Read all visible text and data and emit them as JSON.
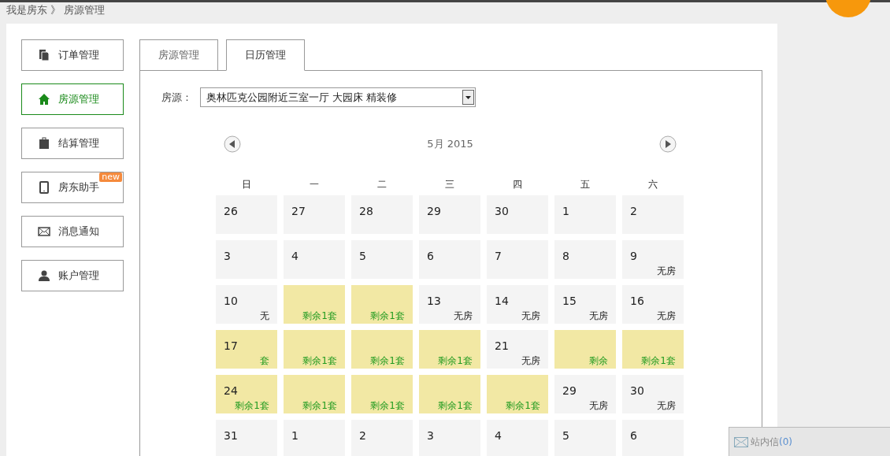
{
  "breadcrumb": {
    "parent": "我是房东",
    "separator": "》",
    "current": "房源管理"
  },
  "sidebar": {
    "items": [
      {
        "label": "订单管理",
        "selected": false
      },
      {
        "label": "房源管理",
        "selected": true
      },
      {
        "label": "结算管理",
        "selected": false
      },
      {
        "label": "房东助手",
        "selected": false,
        "badge": "new"
      },
      {
        "label": "消息通知",
        "selected": false
      },
      {
        "label": "账户管理",
        "selected": false
      }
    ]
  },
  "tabs": [
    {
      "label": "房源管理",
      "selected": false
    },
    {
      "label": "日历管理",
      "selected": true
    }
  ],
  "listing": {
    "label": "房源：",
    "value": "奥林匹克公园附近三室一厅 大园床 精装修"
  },
  "calendar": {
    "month": "5月 2015",
    "weekdays": [
      "日",
      "一",
      "二",
      "三",
      "四",
      "五",
      "六"
    ],
    "days": [
      {
        "day": "26",
        "kind": "plain"
      },
      {
        "day": "27",
        "kind": "plain"
      },
      {
        "day": "28",
        "kind": "plain"
      },
      {
        "day": "29",
        "kind": "plain"
      },
      {
        "day": "30",
        "kind": "plain"
      },
      {
        "day": "1",
        "kind": "plain"
      },
      {
        "day": "2",
        "kind": "plain"
      },
      {
        "day": "3",
        "kind": "plain"
      },
      {
        "day": "4",
        "kind": "plain"
      },
      {
        "day": "5",
        "kind": "plain"
      },
      {
        "day": "6",
        "kind": "plain"
      },
      {
        "day": "7",
        "kind": "plain"
      },
      {
        "day": "8",
        "kind": "plain"
      },
      {
        "day": "9",
        "kind": "none",
        "status": "无房"
      },
      {
        "day": "10",
        "kind": "none",
        "status": "无"
      },
      {
        "kind": "available",
        "status": "剩余1套"
      },
      {
        "kind": "available",
        "status": "剩余1套"
      },
      {
        "day": "13",
        "kind": "none",
        "status": "无房"
      },
      {
        "day": "14",
        "kind": "none",
        "status": "无房"
      },
      {
        "day": "15",
        "kind": "none",
        "status": "无房"
      },
      {
        "day": "16",
        "kind": "none",
        "status": "无房"
      },
      {
        "day": "17",
        "kind": "available",
        "status": "套"
      },
      {
        "kind": "available",
        "status": "剩余1套"
      },
      {
        "kind": "available",
        "status": "剩余1套"
      },
      {
        "kind": "available",
        "status": "剩余1套"
      },
      {
        "day": "21",
        "kind": "none",
        "status": "无房"
      },
      {
        "kind": "available",
        "status": "剩余"
      },
      {
        "kind": "available",
        "status": "剩余1套"
      },
      {
        "day": "24",
        "kind": "available",
        "status": "剩余1套"
      },
      {
        "kind": "available",
        "status": "剩余1套"
      },
      {
        "kind": "available",
        "status": "剩余1套"
      },
      {
        "kind": "available",
        "status": "剩余1套"
      },
      {
        "kind": "available",
        "status": "剩余1套"
      },
      {
        "day": "29",
        "kind": "none",
        "status": "无房"
      },
      {
        "day": "30",
        "kind": "none",
        "status": "无房"
      },
      {
        "day": "31",
        "kind": "plain"
      },
      {
        "day": "1",
        "kind": "plain"
      },
      {
        "day": "2",
        "kind": "plain"
      },
      {
        "day": "3",
        "kind": "plain"
      },
      {
        "day": "4",
        "kind": "plain"
      },
      {
        "day": "5",
        "kind": "plain"
      },
      {
        "day": "6",
        "kind": "plain"
      }
    ]
  },
  "messages": {
    "label": "站内信",
    "count": "(0)"
  }
}
